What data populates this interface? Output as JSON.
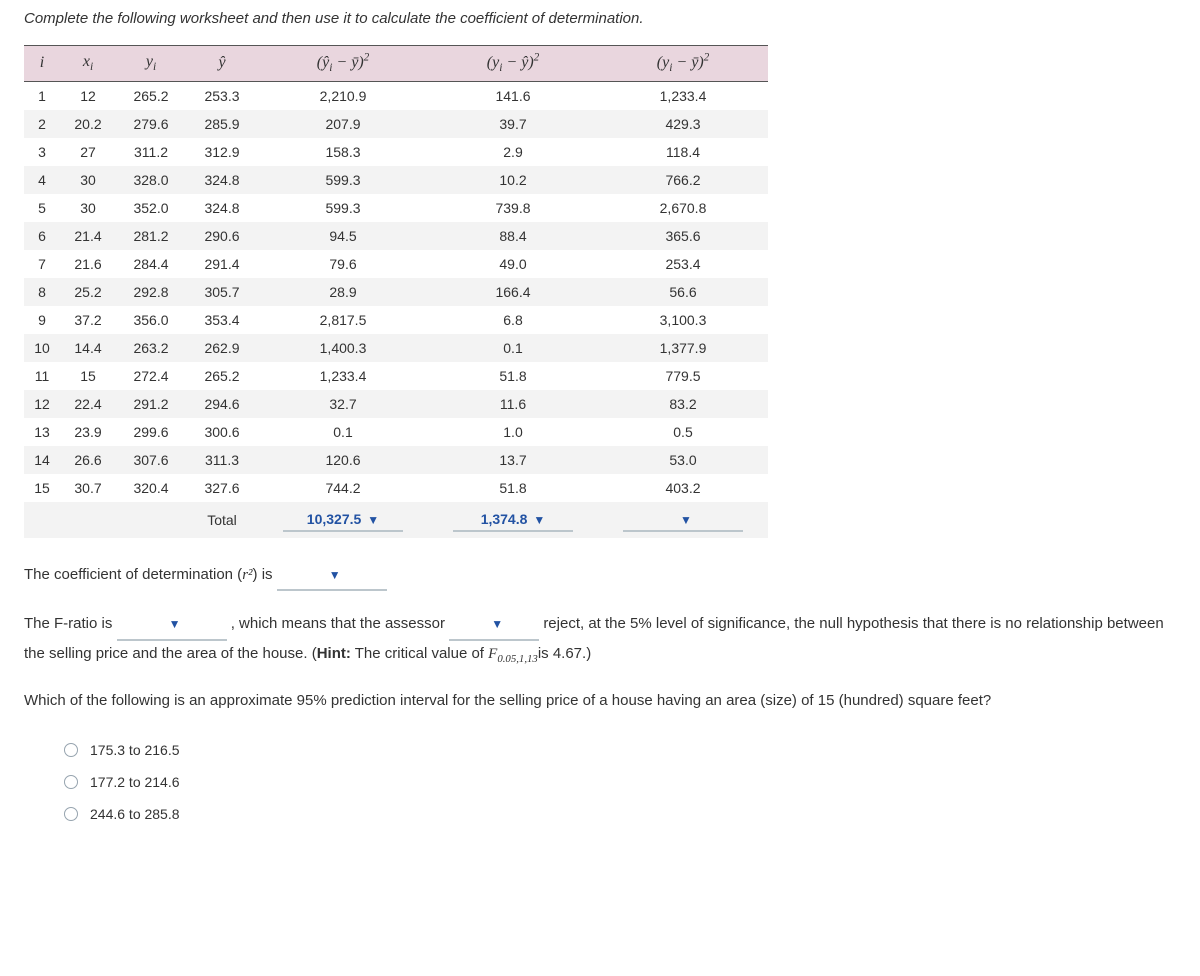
{
  "instruction": "Complete the following worksheet and then use it to calculate the coefficient of determination.",
  "headers": {
    "i": "i",
    "x": "x",
    "y": "y",
    "yhat": "ŷ",
    "c1": "(ŷᵢ − ȳ)²",
    "c2": "(yᵢ − ŷ)²",
    "c3": "(yᵢ − ȳ)²",
    "xi_sub": "i",
    "yi_sub": "i"
  },
  "rows": [
    {
      "i": "1",
      "x": "12",
      "y": "265.2",
      "yhat": "253.3",
      "c1": "2,210.9",
      "c2": "141.6",
      "c3": "1,233.4"
    },
    {
      "i": "2",
      "x": "20.2",
      "y": "279.6",
      "yhat": "285.9",
      "c1": "207.9",
      "c2": "39.7",
      "c3": "429.3"
    },
    {
      "i": "3",
      "x": "27",
      "y": "311.2",
      "yhat": "312.9",
      "c1": "158.3",
      "c2": "2.9",
      "c3": "118.4"
    },
    {
      "i": "4",
      "x": "30",
      "y": "328.0",
      "yhat": "324.8",
      "c1": "599.3",
      "c2": "10.2",
      "c3": "766.2"
    },
    {
      "i": "5",
      "x": "30",
      "y": "352.0",
      "yhat": "324.8",
      "c1": "599.3",
      "c2": "739.8",
      "c3": "2,670.8"
    },
    {
      "i": "6",
      "x": "21.4",
      "y": "281.2",
      "yhat": "290.6",
      "c1": "94.5",
      "c2": "88.4",
      "c3": "365.6"
    },
    {
      "i": "7",
      "x": "21.6",
      "y": "284.4",
      "yhat": "291.4",
      "c1": "79.6",
      "c2": "49.0",
      "c3": "253.4"
    },
    {
      "i": "8",
      "x": "25.2",
      "y": "292.8",
      "yhat": "305.7",
      "c1": "28.9",
      "c2": "166.4",
      "c3": "56.6"
    },
    {
      "i": "9",
      "x": "37.2",
      "y": "356.0",
      "yhat": "353.4",
      "c1": "2,817.5",
      "c2": "6.8",
      "c3": "3,100.3"
    },
    {
      "i": "10",
      "x": "14.4",
      "y": "263.2",
      "yhat": "262.9",
      "c1": "1,400.3",
      "c2": "0.1",
      "c3": "1,377.9"
    },
    {
      "i": "11",
      "x": "15",
      "y": "272.4",
      "yhat": "265.2",
      "c1": "1,233.4",
      "c2": "51.8",
      "c3": "779.5"
    },
    {
      "i": "12",
      "x": "22.4",
      "y": "291.2",
      "yhat": "294.6",
      "c1": "32.7",
      "c2": "11.6",
      "c3": "83.2"
    },
    {
      "i": "13",
      "x": "23.9",
      "y": "299.6",
      "yhat": "300.6",
      "c1": "0.1",
      "c2": "1.0",
      "c3": "0.5"
    },
    {
      "i": "14",
      "x": "26.6",
      "y": "307.6",
      "yhat": "311.3",
      "c1": "120.6",
      "c2": "13.7",
      "c3": "53.0"
    },
    {
      "i": "15",
      "x": "30.7",
      "y": "320.4",
      "yhat": "327.6",
      "c1": "744.2",
      "c2": "51.8",
      "c3": "403.2"
    }
  ],
  "totals": {
    "label": "Total",
    "c1": "10,327.5",
    "c2": "1,374.8",
    "c3": ""
  },
  "coeff_sentence": {
    "pre": "The coefficient of determination (",
    "r2": "r²",
    "post": ") is "
  },
  "f_sentence": {
    "p1": "The F-ratio is ",
    "p2": " , which means that the assessor ",
    "p3": " reject, at the 5% level of significance, the null hypothesis that there is no relationship between the selling price and the area of the house. (",
    "hint_label": "Hint:",
    "hint_text": " The critical value of ",
    "f_sym": "F",
    "f_sub": "0.05,1,13",
    "hint_tail": "is 4.67.)"
  },
  "pi_question": "Which of the following is an approximate 95% prediction interval for the selling price of a house having an area (size) of 15 (hundred) square feet?",
  "options": [
    "175.3 to 216.5",
    "177.2 to 214.6",
    "244.6 to 285.8"
  ]
}
